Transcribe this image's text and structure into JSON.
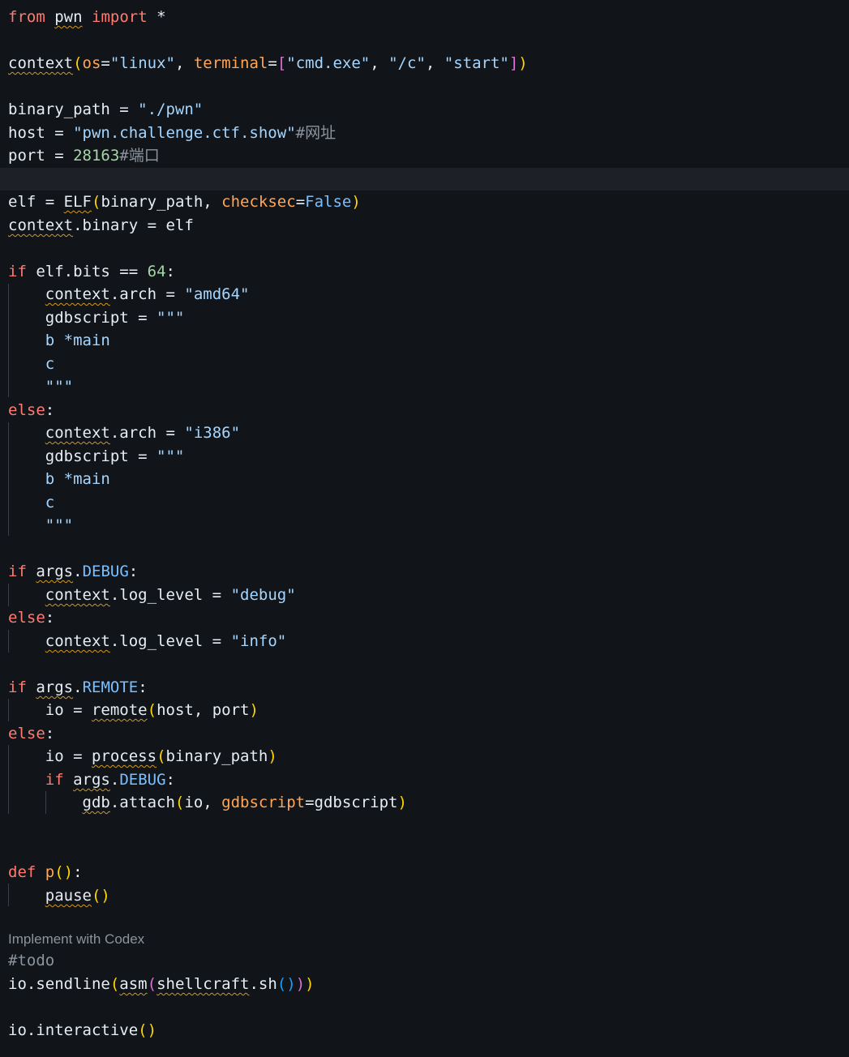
{
  "codelens": {
    "implement_with_codex": "Implement with Codex"
  },
  "code": {
    "from_kw": "from",
    "pwn_mod": "pwn",
    "import_kw": "import",
    "star": " *",
    "context_fn": "context",
    "os_param": "os",
    "eq": "=",
    "linux_str": "\"linux\"",
    "comma_sp": ", ",
    "terminal_param": "terminal",
    "cmd_str": "\"cmd.exe\"",
    "c_flag_str": "\"/c\"",
    "start_str": "\"start\"",
    "binary_path_name": "binary_path",
    "assign": " = ",
    "binary_path_str": "\"./pwn\"",
    "host_name": "host",
    "host_str": "\"pwn.challenge.ctf.show\"",
    "host_comment": "#网址",
    "port_name": "port",
    "port_num": "28163",
    "port_comment": "#端口",
    "elf_name": "elf",
    "elf_cls": "ELF",
    "binary_path_arg": "binary_path",
    "checksec_param": "checksec",
    "false_kw": "False",
    "context_obj": "context",
    "dot_binary": ".binary",
    "elf_val": "elf",
    "if_kw": "if",
    "elf_bits": "elf.bits",
    "eqeq": " == ",
    "bits_num": "64",
    "colon": ":",
    "dot_arch": ".arch",
    "amd64_str": "\"amd64\"",
    "gdbscript_name": "gdbscript",
    "triple_quote": "\"\"\"",
    "b_main": "b *main",
    "c_line": "c",
    "else_kw": "else",
    "i386_str": "\"i386\"",
    "args_obj": "args",
    "debug_attr": "DEBUG",
    "dot": ".",
    "log_level": ".log_level",
    "debug_str": "\"debug\"",
    "info_str": "\"info\"",
    "remote_attr": "REMOTE",
    "io_name": "io",
    "remote_fn": "remote",
    "host_port_args": "host, port",
    "process_fn": "process",
    "gdb_obj": "gdb",
    "attach_call": ".attach",
    "io_arg": "io, ",
    "gdbscript_param": "gdbscript",
    "gdbscript_val": "gdbscript",
    "def_kw": "def",
    "p_fn": "p",
    "pause_fn": "pause",
    "todo_comment": "#todo",
    "io_sendline": "io.sendline",
    "asm_fn": "asm",
    "shellcraft_obj": "shellcraft",
    "sh_call": ".sh",
    "io_interactive": "io.interactive",
    "paren_open": "(",
    "paren_close": ")",
    "brack_open": "[",
    "brack_close": "]",
    "parens": "()"
  }
}
